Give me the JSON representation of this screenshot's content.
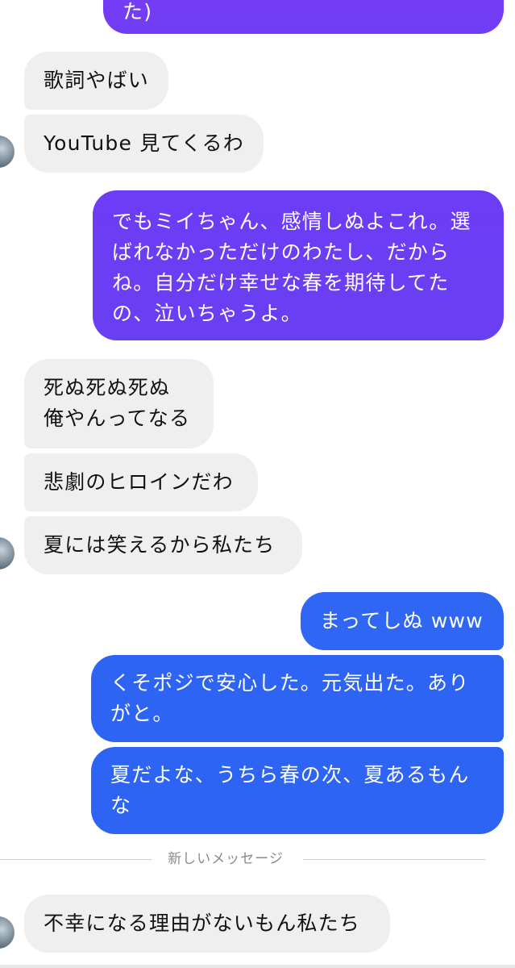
{
  "messages": [
    {
      "direction": "sent",
      "text": "た)"
    },
    {
      "direction": "received",
      "text": "歌詞やばい"
    },
    {
      "direction": "received",
      "text": "YouTube 見てくるわ"
    },
    {
      "direction": "sent",
      "text": "でもミイちゃん、感情しぬよこれ。選ばれなかっただけのわたし、だからね。自分だけ幸せな春を期待してたの、泣いちゃうよ。"
    },
    {
      "direction": "received",
      "text": "死ぬ死ぬ死ぬ\n俺やんってなる"
    },
    {
      "direction": "received",
      "text": "悲劇のヒロインだわ"
    },
    {
      "direction": "received",
      "text": "夏には笑えるから私たち"
    },
    {
      "direction": "sent",
      "text": "まってしぬ www"
    },
    {
      "direction": "sent",
      "text": "くそポジで安心した。元気出た。ありがと。"
    },
    {
      "direction": "sent",
      "text": "夏だよな、うちら春の次、夏あるもんな"
    },
    {
      "direction": "received",
      "text": "不幸になる理由がないもん私たち"
    }
  ],
  "new_messages_divider": "新しいメッセージ",
  "colors": {
    "received_bubble": "#efefef",
    "sent_purple_top": "#6d3cf6",
    "sent_purple_bottom": "#6a3ff2",
    "sent_blue": "#2d64f3",
    "sent_blue_alt": "#2e66f5"
  }
}
